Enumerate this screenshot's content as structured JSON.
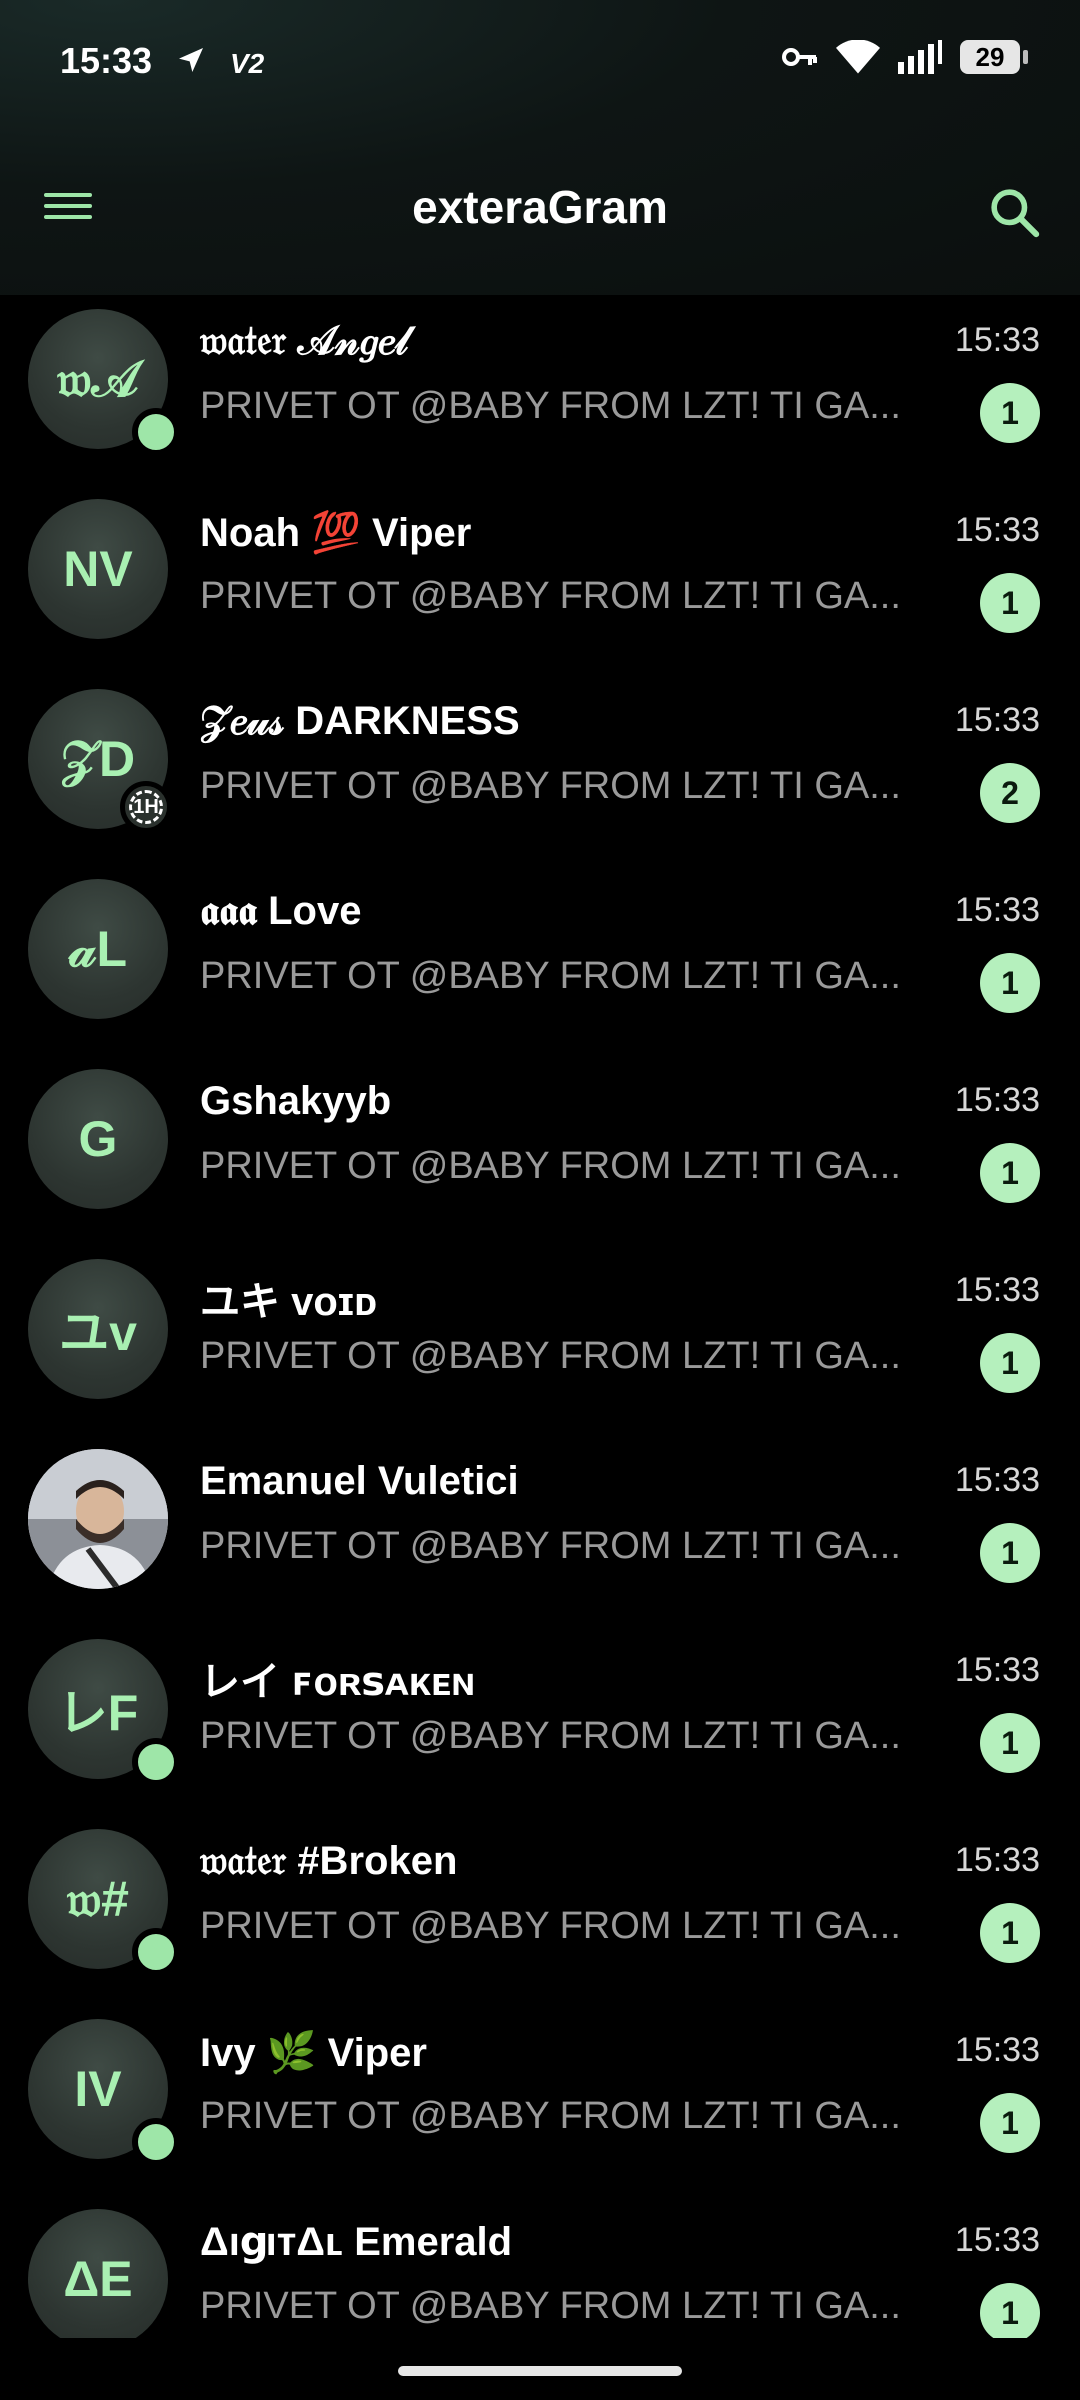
{
  "status_bar": {
    "time": "15:33",
    "network_badge": "V2",
    "battery": "29",
    "icons": [
      "location-arrow-icon",
      "vpn-key-icon",
      "wifi-icon",
      "signal-icon",
      "battery-icon"
    ]
  },
  "header": {
    "title": "exteraGram",
    "menu_icon": "hamburger-menu-icon",
    "search_icon": "search-icon",
    "accent_color": "#9ee6a8"
  },
  "chats": [
    {
      "initials": "𝔴𝒜",
      "name": "𝔴𝔞𝔱𝔢𝔯 𝒜𝓃𝑔𝑒𝓁",
      "message": "PRIVET OT @BABY FROM LZT! TI GA...",
      "time": "15:33",
      "unread": "1",
      "online": true,
      "timer": ""
    },
    {
      "initials": "NV",
      "name": "Noah 💯 Viper",
      "message": "PRIVET OT @BABY FROM LZT! TI GA...",
      "time": "15:33",
      "unread": "1",
      "online": false,
      "timer": ""
    },
    {
      "initials": "𝒵D",
      "name": "𝒵𝑒𝓊𝓈 DARKNESS",
      "message": "PRIVET OT @BABY FROM LZT! TI GA...",
      "time": "15:33",
      "unread": "2",
      "online": false,
      "timer": "1H"
    },
    {
      "initials": "𝒶L",
      "name": "𝖆𝖆𝖆 Love",
      "message": "PRIVET OT @BABY FROM LZT! TI GA...",
      "time": "15:33",
      "unread": "1",
      "online": false,
      "timer": ""
    },
    {
      "initials": "G",
      "name": "Gshakyyb",
      "message": "PRIVET OT @BABY FROM LZT! TI GA...",
      "time": "15:33",
      "unread": "1",
      "online": false,
      "timer": ""
    },
    {
      "initials": "ユv",
      "name": "ユキ ᴠᴏɪᴅ",
      "message": "PRIVET OT @BABY FROM LZT! TI GA...",
      "time": "15:33",
      "unread": "1",
      "online": false,
      "timer": ""
    },
    {
      "initials": "",
      "name": "Emanuel Vuletici",
      "message": "PRIVET OT @BABY FROM LZT! TI GA...",
      "time": "15:33",
      "unread": "1",
      "online": false,
      "timer": "",
      "photo": true
    },
    {
      "initials": "レF",
      "name": "レイ ꜰᴏʀꜱᴀᴋᴇɴ",
      "message": "PRIVET OT @BABY FROM LZT! TI GA...",
      "time": "15:33",
      "unread": "1",
      "online": true,
      "timer": ""
    },
    {
      "initials": "𝔴#",
      "name": "𝔴𝔞𝔱𝔢𝔯 #Broken",
      "message": "PRIVET OT @BABY FROM LZT! TI GA...",
      "time": "15:33",
      "unread": "1",
      "online": true,
      "timer": ""
    },
    {
      "initials": "IV",
      "name": "Ivy 🌿 Viper",
      "message": "PRIVET OT @BABY FROM LZT! TI GA...",
      "time": "15:33",
      "unread": "1",
      "online": true,
      "timer": ""
    },
    {
      "initials": "ΔE",
      "name": "ΔıցıтΔʟ Emerald",
      "message": "PRIVET OT @BABY FROM LZT! TI GA...",
      "time": "15:33",
      "unread": "1",
      "online": false,
      "timer": ""
    }
  ]
}
